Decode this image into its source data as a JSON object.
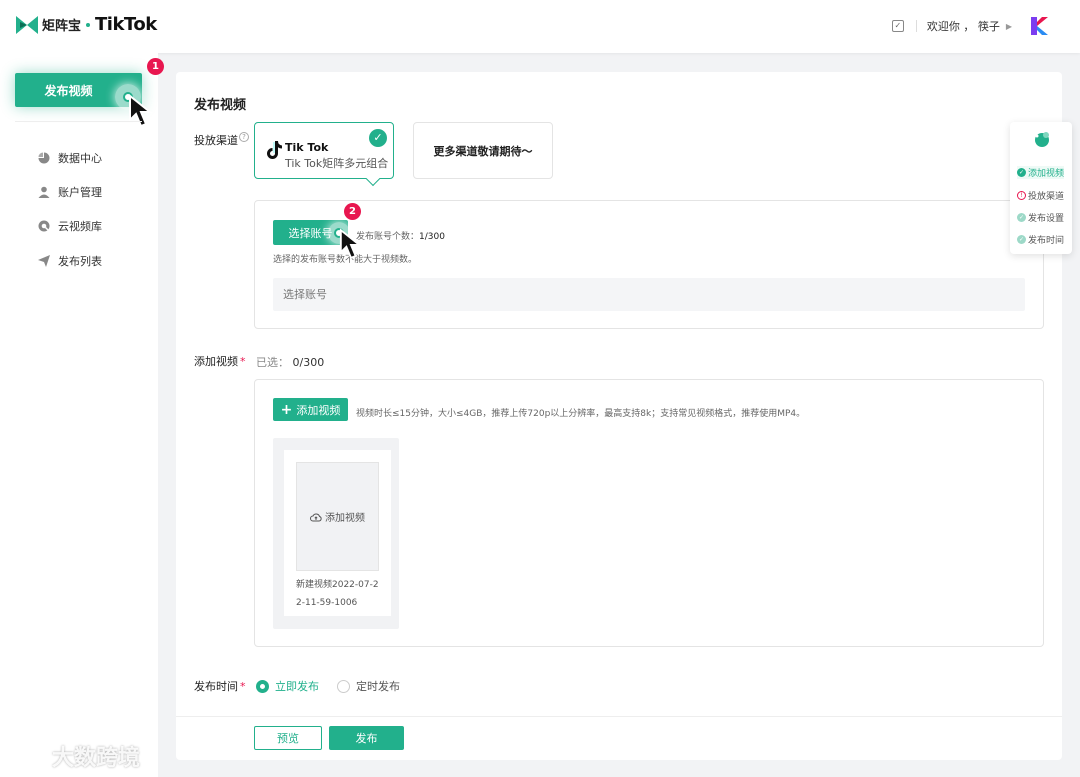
{
  "header": {
    "logo_cn": "矩阵宝",
    "logo_tiktok": "TikTok",
    "welcome": "欢迎你 ， 筷子",
    "caret": "▶"
  },
  "sidebar": {
    "publish_label": "发布视频",
    "publish_badge": "1",
    "items": [
      {
        "label": "数据中心",
        "icon": "pie-chart-icon"
      },
      {
        "label": "账户管理",
        "icon": "user-icon"
      },
      {
        "label": "云视频库",
        "icon": "cloud-search-icon"
      },
      {
        "label": "发布列表",
        "icon": "send-icon"
      }
    ]
  },
  "main": {
    "title": "发布视频",
    "channel": {
      "label": "投放渠道",
      "help": "?",
      "tiktok_name": "Tik Tok",
      "tiktok_sub": "Tik Tok矩阵多元组合",
      "check": "✓",
      "more": "更多渠道敬请期待～"
    },
    "account": {
      "select_button": "选择账号",
      "badge": "2",
      "count_label": "发布账号个数：",
      "count_value": "1/300",
      "hint": "选择的发布账号数不能大于视频数。",
      "input_placeholder": "选择账号"
    },
    "video": {
      "label": "添加视频",
      "selected_label": "已选：",
      "selected_value": "0/300",
      "add_button": "添加视频",
      "add_plus": "+",
      "hint": "视频时长≤15分钟，大小≤4GB，推荐上传720p以上分辨率，最高支持8k；支持常见视频格式，推荐使用MP4。",
      "slot_label": "添加视频",
      "file_name": "新建视频2022-07-22-11-59-1006"
    },
    "publish_time": {
      "label": "发布时间",
      "options": [
        "立即发布",
        "定时发布"
      ],
      "selected": "立即发布"
    },
    "footer": {
      "preview": "预览",
      "publish": "发布"
    }
  },
  "steps": [
    {
      "label": "添加视频",
      "state": "done"
    },
    {
      "label": "投放渠道",
      "state": "warning"
    },
    {
      "label": "发布设置",
      "state": "done"
    },
    {
      "label": "发布时间",
      "state": "done"
    }
  ],
  "watermark": "大数跨境",
  "colors": {
    "accent": "#22b08c",
    "badge": "#e8164f",
    "background": "#f2f3f5"
  }
}
